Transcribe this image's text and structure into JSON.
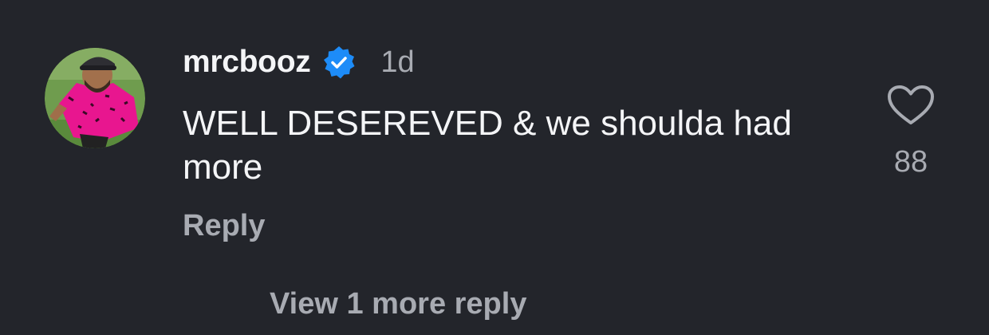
{
  "comment": {
    "username": "mrcbooz",
    "verified": true,
    "timestamp": "1d",
    "text": "WELL DESEREVED & we shoulda had more",
    "reply_label": "Reply",
    "like_count": "88",
    "view_replies_label": "View 1 more reply"
  },
  "colors": {
    "background": "#23252b",
    "text_primary": "#f4f5f7",
    "text_secondary": "#a8abb2",
    "verified_badge": "#1d8cf8"
  },
  "icons": {
    "verified": "verified-badge-icon",
    "like": "heart-outline-icon"
  }
}
